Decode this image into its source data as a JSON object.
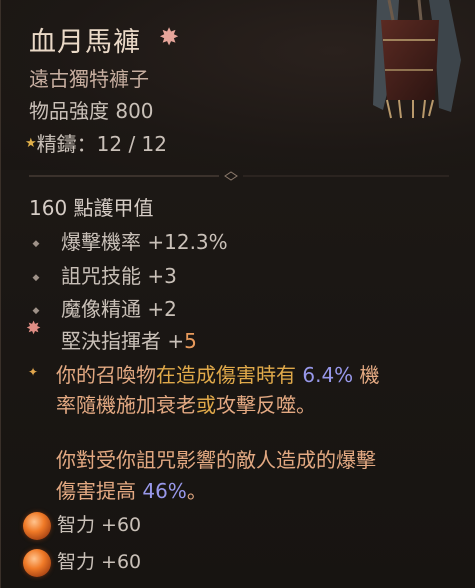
{
  "item": {
    "name": "血月馬褲",
    "type": "遠古獨特褲子",
    "power": "物品強度 800",
    "masterwork_star": "★",
    "masterwork": "精鑄：12 / 12"
  },
  "armor": "160 點護甲值",
  "affixes": [
    {
      "label": "爆擊機率 +12.3%"
    },
    {
      "label": "詛咒技能 +3"
    },
    {
      "label": "魔像精通 +2"
    }
  ],
  "bonus_affix": {
    "label": "堅決指揮者 +",
    "value": "5"
  },
  "legendary": {
    "line1_a": "你的召喚物",
    "line1_b": "在造成傷害時有",
    "line1_c": "6.4%",
    "line1_d": " 機",
    "line2_a": "率隨機施加",
    "line2_b": "衰老",
    "line2_c": "或",
    "line2_d": "攻擊反噬",
    "line2_e": "。",
    "line3": "你對受你詛咒影響的敵人造成的爆擊",
    "line4_a": "傷害提高 ",
    "line4_b": "46%",
    "line4_c": "。"
  },
  "sockets": [
    {
      "label": "智力 +60"
    },
    {
      "label": "智力 +60"
    }
  ],
  "colors": {
    "name": "#ead9c7",
    "unique": "#e6a59a",
    "legendary_text": "#e3a982",
    "legendary_number": "#9898ea",
    "bonus_value": "#e89a5c"
  },
  "icons": {
    "unique": "unique-flower-icon",
    "bullet": "diamond-bullet-icon",
    "gem": "topaz-gem-icon"
  }
}
